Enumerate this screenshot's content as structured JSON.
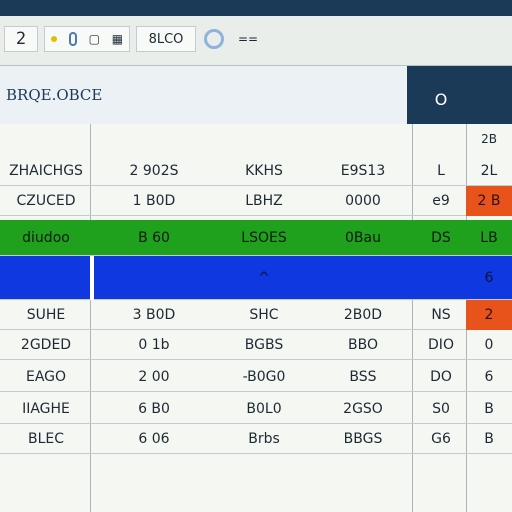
{
  "toolbar": {
    "cell_number": "2",
    "icon_names": [
      "yellow-dot-icon",
      "toggle-icon",
      "square-icon",
      "grid-icon"
    ],
    "ref_text": "8LCO",
    "misc_text": "=="
  },
  "header": {
    "title": "BRQE.OBCE",
    "button": "O"
  },
  "grid": {
    "column_headers": [
      "",
      "",
      "",
      "",
      "",
      "2B"
    ],
    "rows": [
      {
        "cells": [
          "ZHAICHGS",
          "2 902S",
          "KKHS",
          "E9S13",
          "L",
          "2L"
        ],
        "style": ""
      },
      {
        "cells": [
          "CZUCED",
          "1 B0D",
          "LBHZ",
          "0000",
          "e9",
          "2 B"
        ],
        "style": "orange-last"
      },
      {
        "cells": [
          "diudoo",
          "B 60",
          "LSOES",
          "0Bau",
          "DS",
          "LB"
        ],
        "style": "green"
      },
      {
        "cells": [
          "",
          "",
          "^",
          "",
          "",
          "6"
        ],
        "style": "blue"
      },
      {
        "cells": [
          "SUHE",
          "3 B0D",
          "SHC",
          "2B0D",
          "NS",
          "2"
        ],
        "style": "orange-last"
      },
      {
        "cells": [
          "2GDED",
          "0 1b",
          "BGBS",
          "BBO",
          "DIO",
          "0"
        ],
        "style": ""
      },
      {
        "cells": [
          "EAGO",
          "2 00",
          "-B0G0",
          "BSS",
          "DO",
          "6"
        ],
        "style": ""
      },
      {
        "cells": [
          "IIAGHE",
          "6 B0",
          "B0L0",
          "2GSO",
          "S0",
          "B"
        ],
        "style": ""
      },
      {
        "cells": [
          "BLEC",
          "6 06",
          "Brbs",
          "BBGS",
          "G6",
          "B"
        ],
        "style": ""
      }
    ]
  }
}
